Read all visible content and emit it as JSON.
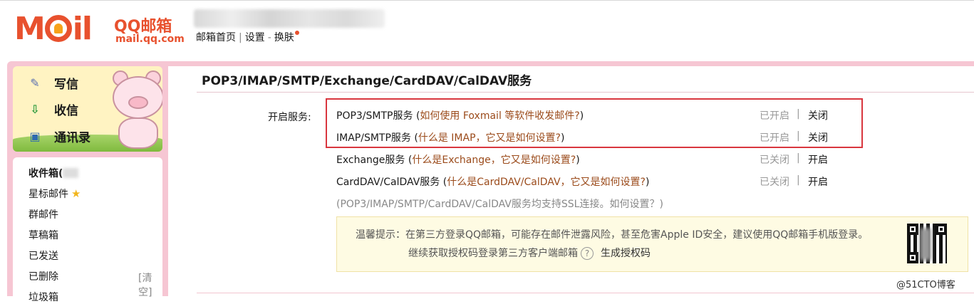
{
  "header": {
    "logo_moil": "M  il",
    "logo_qq": "QQ邮箱",
    "logo_domain": "mail.qq.com",
    "links": [
      {
        "label": "邮箱首页"
      },
      {
        "label": "设置"
      },
      {
        "label": "换肤"
      }
    ],
    "sep_pipe": "|",
    "sep_dash": "-"
  },
  "sidebar": {
    "quick": [
      {
        "label": "写信",
        "icon": "pencil-icon"
      },
      {
        "label": "收信",
        "icon": "inbox-download-icon"
      },
      {
        "label": "通讯录",
        "icon": "contact-card-icon"
      }
    ],
    "folders": [
      {
        "label": "收件箱("
      },
      {
        "label": "星标邮件"
      },
      {
        "label": "群邮件"
      },
      {
        "label": "草稿箱"
      },
      {
        "label": "已发送"
      },
      {
        "label": "已删除"
      },
      {
        "label": "垃圾箱"
      }
    ],
    "clear_label": "[清空]"
  },
  "main": {
    "title": "POP3/IMAP/SMTP/Exchange/CardDAV/CalDAV服务",
    "service_label": "开启服务:",
    "services": [
      {
        "name": "POP3/SMTP服务",
        "help_open": " (",
        "help": "如何使用 Foxmail 等软件收发邮件?",
        "help_close": ")",
        "status": "已开启",
        "action": "关闭"
      },
      {
        "name": "IMAP/SMTP服务",
        "help_open": " (",
        "help": "什么是 IMAP，它又是如何设置?",
        "help_close": ")",
        "status": "已开启",
        "action": "关闭"
      },
      {
        "name": "Exchange服务",
        "help_open": " (",
        "help": "什么是Exchange，它又是如何设置?",
        "help_close": ")",
        "status": "已关闭",
        "action": "开启"
      },
      {
        "name": "CardDAV/CalDAV服务",
        "help_open": " (",
        "help": "什么是CardDAV/CalDAV，它又是如何设置?",
        "help_close": ")",
        "status": "已关闭",
        "action": "开启"
      }
    ],
    "status_sep": "|",
    "ssl_note": "(POP3/IMAP/SMTP/CardDAV/CalDAV服务均支持SSL连接。如何设置？)",
    "tip": {
      "line1": "温馨提示：在第三方登录QQ邮箱，可能存在邮件泄露风险，甚至危害Apple ID安全，建议使用QQ邮箱手机版登录。",
      "line2": "继续获取授权码登录第三方客户端邮箱",
      "help_icon": "?",
      "generate_link": "生成授权码"
    }
  },
  "watermark": "@51CTO博客",
  "colors": {
    "brand": "#e8512e",
    "frame_pink": "#f6c6d3",
    "highlight_red": "#d9363e",
    "help_link": "#9b4b1b",
    "tip_bg": "#fefbe3"
  }
}
